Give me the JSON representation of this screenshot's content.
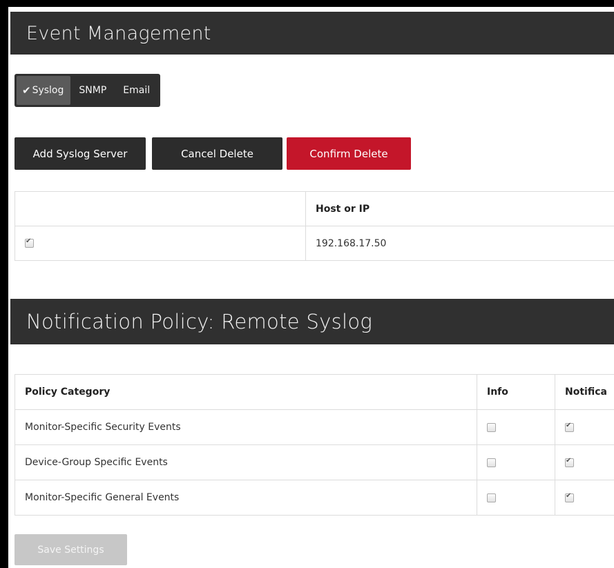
{
  "event_management": {
    "title": "Event Management",
    "tabs": [
      {
        "label": "Syslog",
        "active": true,
        "icon": "check-icon"
      },
      {
        "label": "SNMP",
        "active": false
      },
      {
        "label": "Email",
        "active": false
      }
    ],
    "buttons": {
      "add": "Add Syslog Server",
      "cancel_delete": "Cancel Delete",
      "confirm_delete": "Confirm Delete"
    },
    "servers_table": {
      "headers": [
        "",
        "Host or IP"
      ],
      "rows": [
        {
          "selected": true,
          "host": "192.168.17.50"
        }
      ]
    }
  },
  "notification_policy": {
    "title": "Notification Policy: Remote Syslog",
    "table": {
      "headers": [
        "Policy Category",
        "Info",
        "Notifica"
      ],
      "rows": [
        {
          "category": "Monitor-Specific Security Events",
          "info": false,
          "notification": true
        },
        {
          "category": "Device-Group Specific Events",
          "info": false,
          "notification": true
        },
        {
          "category": "Monitor-Specific General Events",
          "info": false,
          "notification": true
        }
      ]
    },
    "save_label": "Save Settings"
  },
  "colors": {
    "header_bg": "#303030",
    "danger": "#c4162a",
    "disabled": "#c7c7c7"
  }
}
